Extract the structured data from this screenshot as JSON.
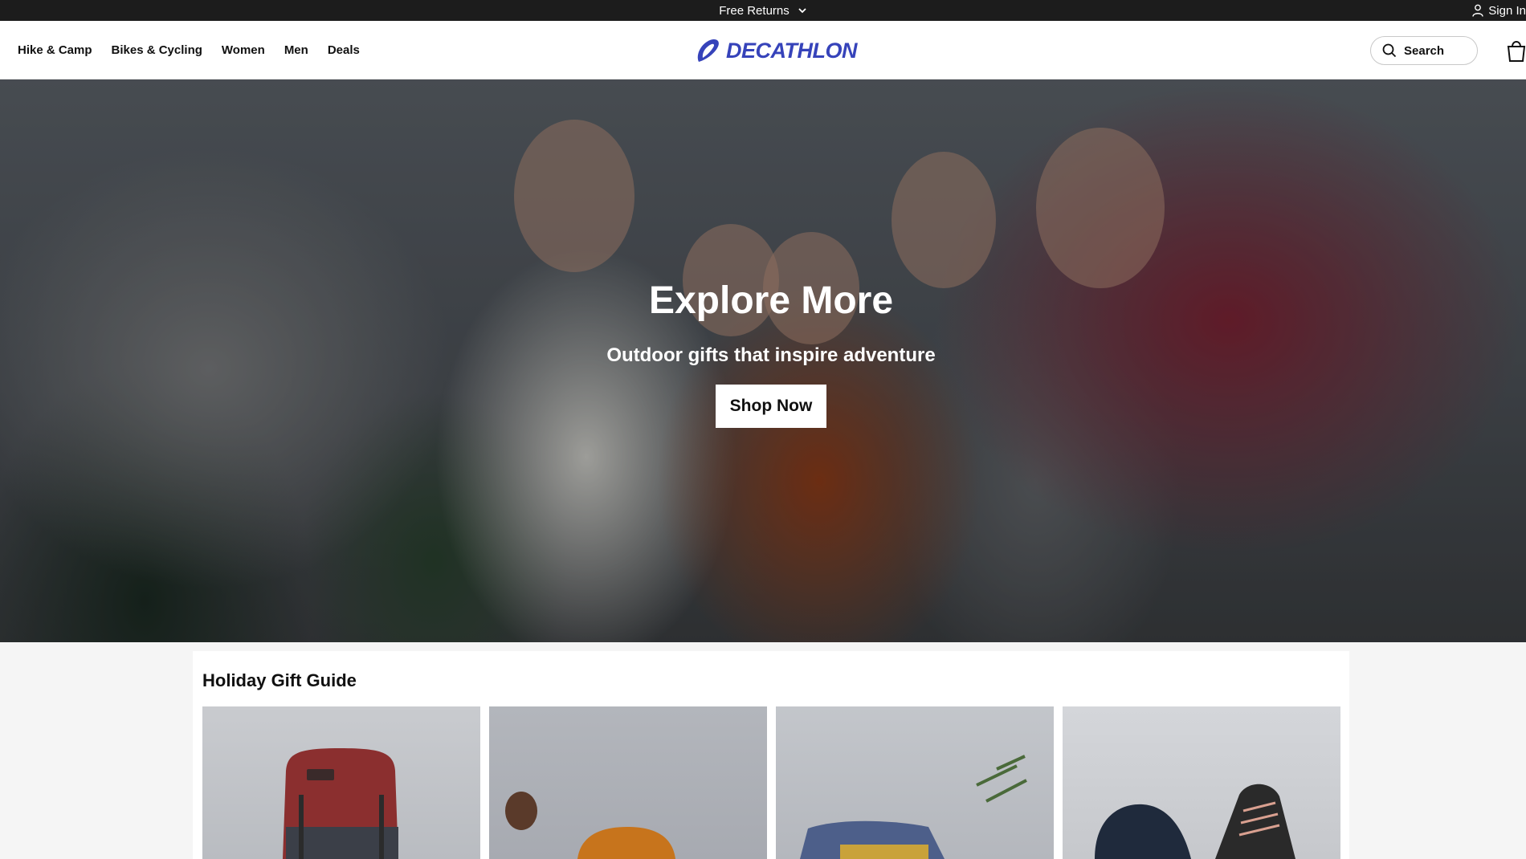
{
  "topbar": {
    "promo_label": "Free Returns",
    "signin_label": "Sign In"
  },
  "header": {
    "nav": [
      "Hike & Camp",
      "Bikes & Cycling",
      "Women",
      "Men",
      "Deals"
    ],
    "logo_text": "DECATHLON",
    "search_label": "Search"
  },
  "hero": {
    "title": "Explore More",
    "subtitle": "Outdoor gifts that inspire adventure",
    "cta_label": "Shop Now"
  },
  "guide": {
    "title": "Holiday Gift Guide"
  },
  "colors": {
    "brand": "#3643ba",
    "topbar": "#1c1c1c"
  }
}
